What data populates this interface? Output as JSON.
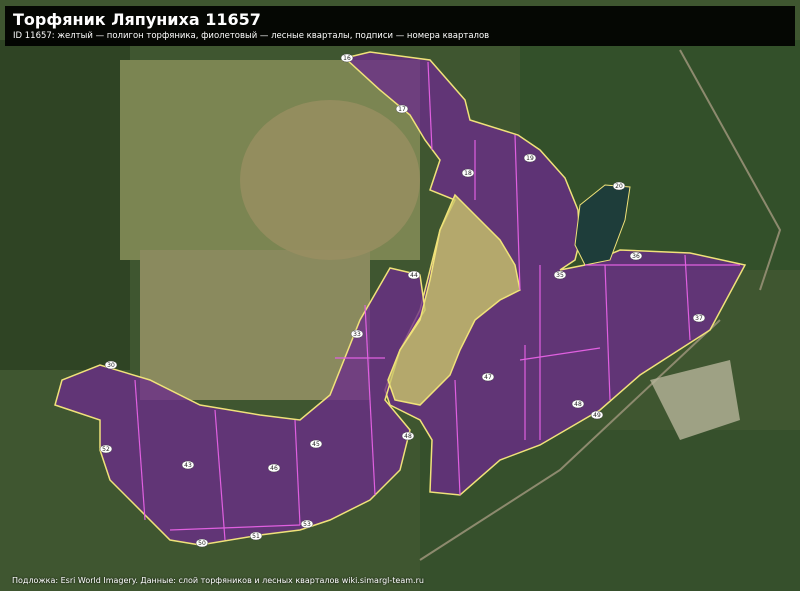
{
  "header": {
    "title": "Торфяник Ляпуниха 11657",
    "subtitle": "ID 11657: желтый — полигон торфяника, фиолетовый — лесные кварталы, подписи — номера кварталов"
  },
  "attribution": "Подложка: Esri World Imagery. Данные: слой торфяников и лесных кварталов wiki.simargl-team.ru",
  "corner_mark": "",
  "legend_colors": {
    "peat_outline": "#f0e27a",
    "quarter_line": "#e060e0",
    "quarter_fill": "#6a2c8a",
    "peat_fill": "#c9c56a"
  },
  "quarter_labels": [
    {
      "id": "q16",
      "text": "16"
    },
    {
      "id": "q17",
      "text": "17"
    },
    {
      "id": "q18",
      "text": "18"
    },
    {
      "id": "q19",
      "text": "19"
    },
    {
      "id": "q20",
      "text": "20"
    },
    {
      "id": "q35",
      "text": "35"
    },
    {
      "id": "q36",
      "text": "36"
    },
    {
      "id": "q37",
      "text": "37"
    },
    {
      "id": "q44",
      "text": "44"
    },
    {
      "id": "q33",
      "text": "33"
    },
    {
      "id": "q47",
      "text": "47"
    },
    {
      "id": "q48",
      "text": "48"
    },
    {
      "id": "q49",
      "text": "49"
    },
    {
      "id": "q48b",
      "text": "48"
    },
    {
      "id": "q30",
      "text": "30"
    },
    {
      "id": "q52",
      "text": "52"
    },
    {
      "id": "q43",
      "text": "43"
    },
    {
      "id": "q46",
      "text": "46"
    },
    {
      "id": "q45",
      "text": "45"
    },
    {
      "id": "q50",
      "text": "50"
    },
    {
      "id": "q51",
      "text": "51"
    },
    {
      "id": "q53",
      "text": "53"
    }
  ]
}
